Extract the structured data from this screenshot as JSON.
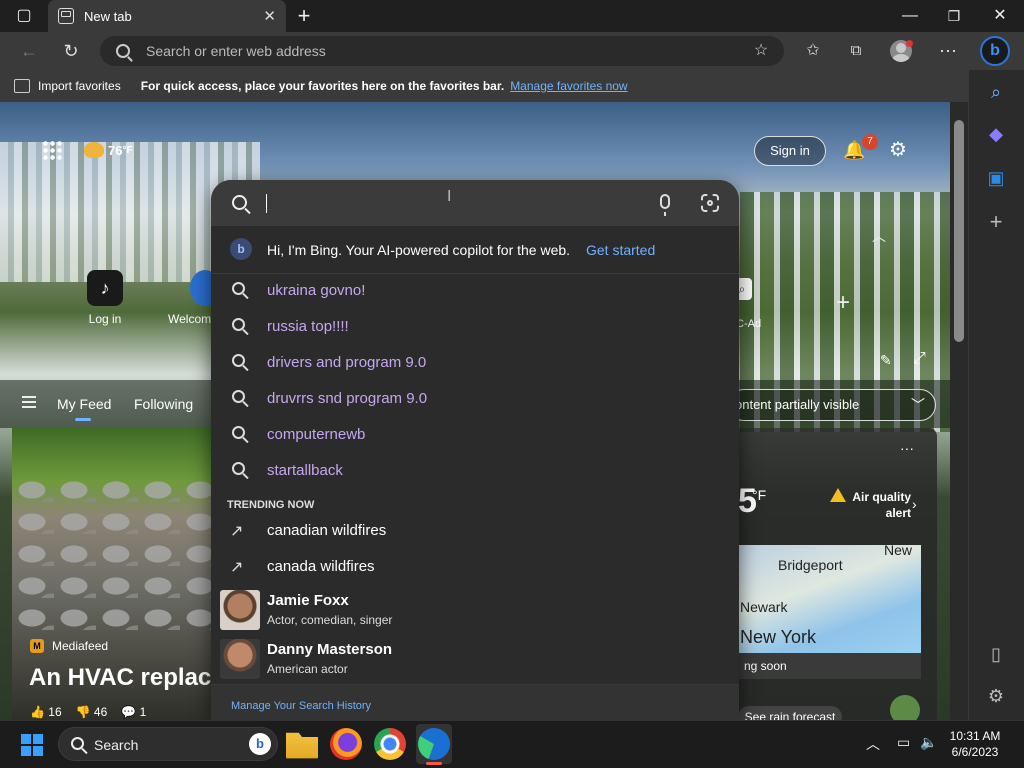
{
  "browser": {
    "tab_title": "New tab",
    "address_placeholder": "Search or enter web address"
  },
  "favorites_bar": {
    "import_label": "Import favorites",
    "message": "For quick access, place your favorites here on the favorites bar.",
    "manage_link": "Manage favorites now"
  },
  "ntp": {
    "weather_temp": "76",
    "weather_unit": "°F",
    "sign_in": "Sign in",
    "notification_count": "7",
    "tiles": [
      {
        "label": "Log in"
      },
      {
        "label": "Welcom"
      }
    ],
    "tile_partial": "C-Ad",
    "nav": {
      "my_feed": "My Feed",
      "following": "Following"
    },
    "content_visibility": "ontent partially visible",
    "article": {
      "source": "Mediafeed",
      "headline": "An HVAC replace",
      "likes": "16",
      "dislikes": "46",
      "comments": "1"
    },
    "weather_card": {
      "temp_partial": "5",
      "unit": "°F",
      "alert": "Air quality alert",
      "map_labels": [
        "New",
        "Bridgeport",
        "Newark",
        "New York"
      ],
      "map_footer": "ng soon",
      "rain_button": "See rain forecast"
    }
  },
  "search_panel": {
    "bing_message": "Hi, I'm Bing. Your AI-powered copilot for the web.",
    "bing_cta": "Get started",
    "history": [
      "ukraina govno!",
      "russia top!!!!",
      "drivers and program 9.0",
      "druvrrs snd program 9.0",
      "computernewb",
      "startallback"
    ],
    "trending_heading": "TRENDING NOW",
    "trending": [
      "canadian wildfires",
      "canada wildfires"
    ],
    "people": [
      {
        "name": "Jamie Foxx",
        "desc": "Actor, comedian, singer"
      },
      {
        "name": "Danny Masterson",
        "desc": "American actor"
      }
    ],
    "manage_history": "Manage Your Search History"
  },
  "taskbar": {
    "search_label": "Search",
    "time": "10:31 AM",
    "date": "6/6/2023"
  }
}
